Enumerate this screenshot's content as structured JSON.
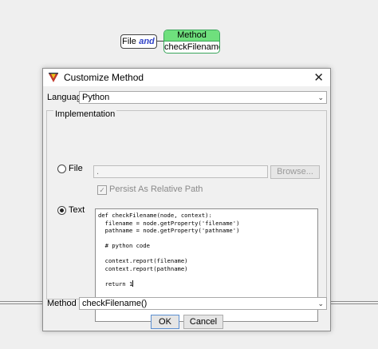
{
  "graph": {
    "file_node": "File",
    "and_node": "and",
    "method_node": {
      "title": "Method",
      "name": "checkFilename"
    }
  },
  "dialog": {
    "title": "Customize Method",
    "language": {
      "label": "Language",
      "value": "Python"
    },
    "implementation": {
      "legend": "Implementation",
      "file_option": "File",
      "file_path": ".",
      "browse_label": "Browse...",
      "persist_label": "Persist As Relative Path",
      "text_option": "Text",
      "selected": "Text",
      "code": "def checkFilename(node, context):\n  filename = node.getProperty('filename')\n  pathname = node.getProperty('pathname')\n\n  # python code\n\n  context.report(filename)\n  context.report(pathname)\n\n  return 1"
    },
    "method": {
      "label": "Method",
      "value": "checkFilename()"
    },
    "ok_label": "OK",
    "cancel_label": "Cancel"
  },
  "icons": {
    "app": "app-logo-icon",
    "close": "close-icon",
    "dropdown": "chevron-down-icon"
  },
  "colors": {
    "method_node_header": "#6fe07d",
    "method_node_border": "#3aa65b",
    "and_text": "#3244c8"
  }
}
